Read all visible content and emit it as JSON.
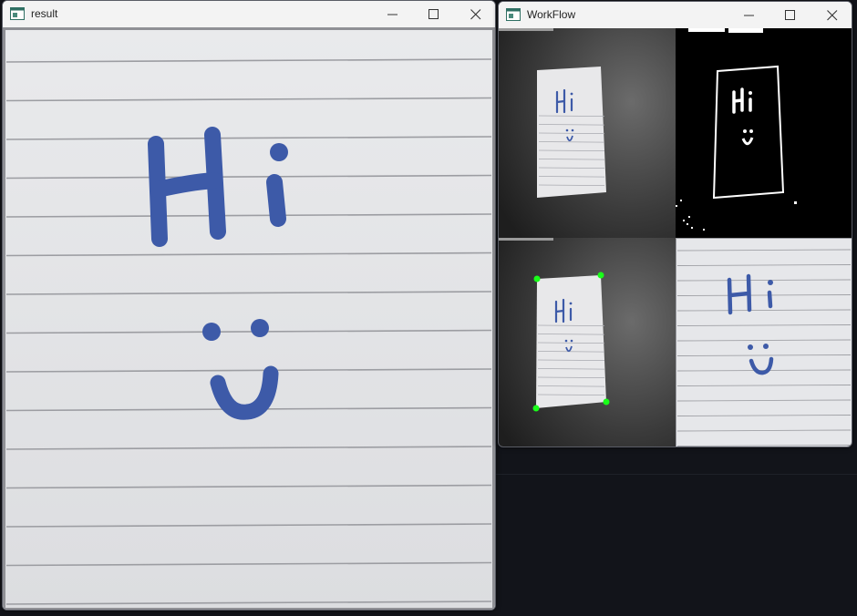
{
  "windows": {
    "result": {
      "title": "result"
    },
    "workflow": {
      "title": "WorkFlow"
    }
  },
  "note": {
    "word": "Hi"
  },
  "colors": {
    "ink": "#3d5aa8",
    "paper": "#e6e7ea",
    "corner_marker": "#19ff19",
    "desktop": "#12141a"
  },
  "icons": {
    "app": "app-window-icon",
    "minimize": "minimize-icon",
    "maximize": "maximize-icon",
    "close": "close-icon"
  }
}
